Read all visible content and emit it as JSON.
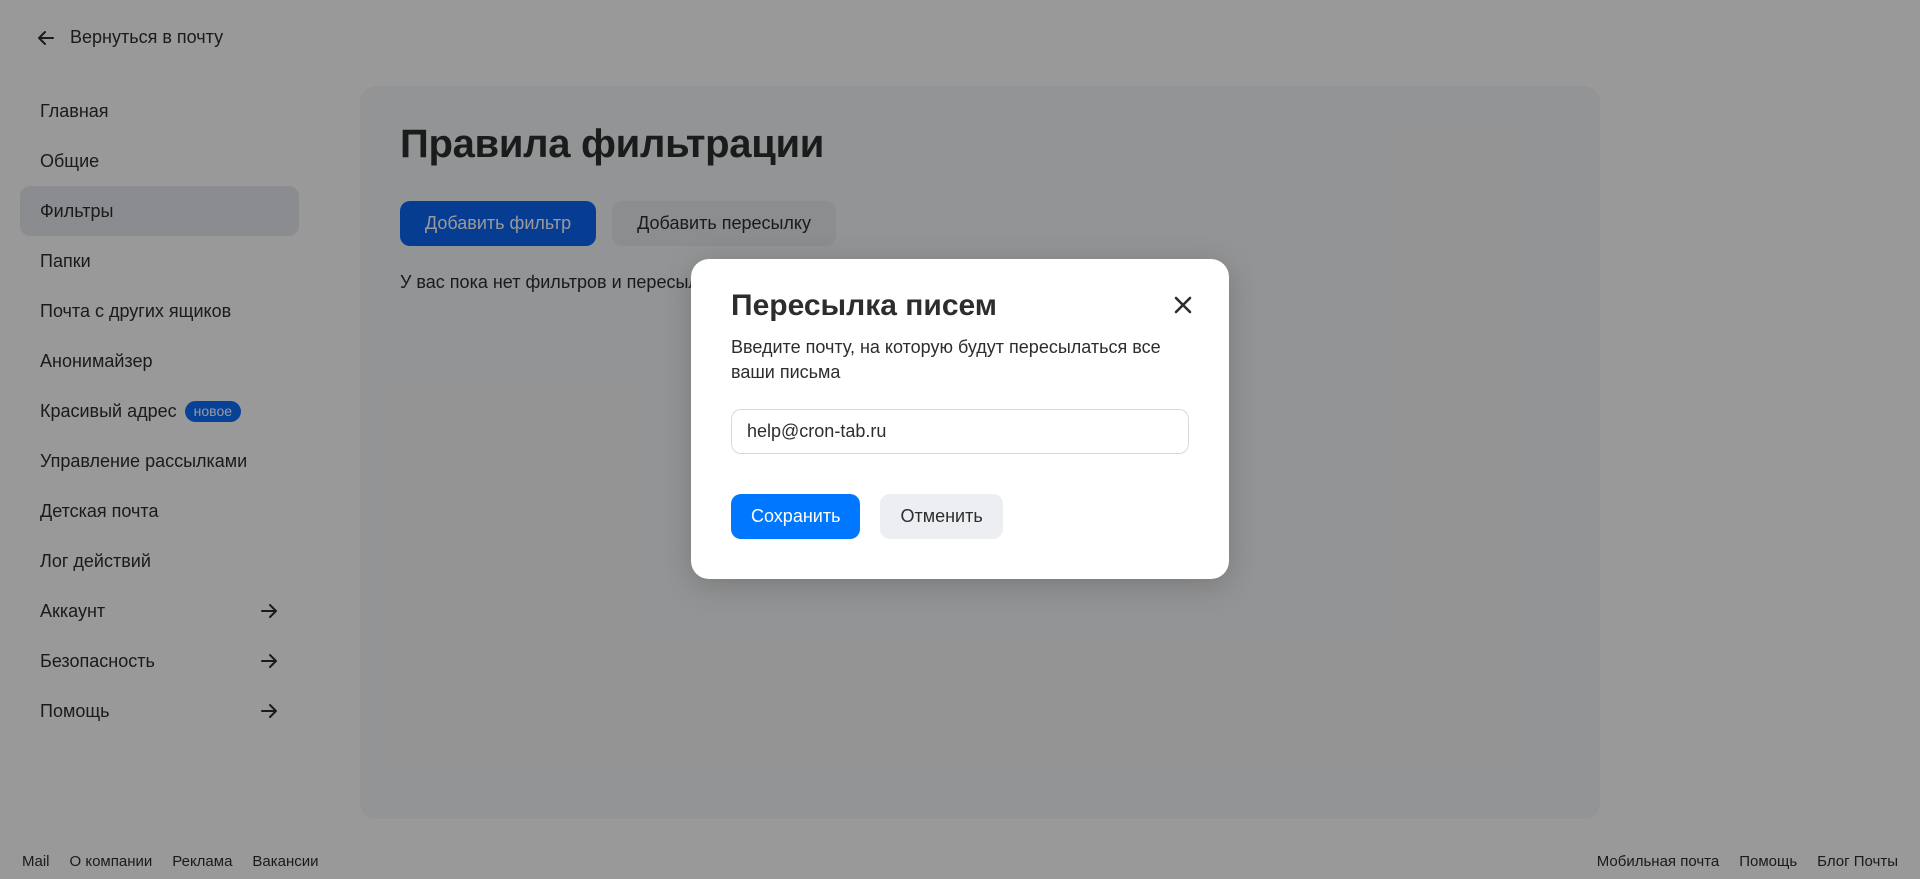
{
  "header": {
    "back_label": "Вернуться в почту"
  },
  "sidebar": {
    "items": [
      {
        "label": "Главная"
      },
      {
        "label": "Общие"
      },
      {
        "label": "Фильтры",
        "active": true
      },
      {
        "label": "Папки"
      },
      {
        "label": "Почта с других ящиков"
      },
      {
        "label": "Анонимайзер"
      },
      {
        "label": "Красивый адрес",
        "badge": "новое"
      },
      {
        "label": "Управление рассылками"
      },
      {
        "label": "Детская почта"
      },
      {
        "label": "Лог действий"
      },
      {
        "label": "Аккаунт",
        "arrow": true
      },
      {
        "label": "Безопасность",
        "arrow": true
      },
      {
        "label": "Помощь",
        "arrow": true
      }
    ]
  },
  "main": {
    "title": "Правила фильтрации",
    "add_filter_label": "Добавить фильтр",
    "add_forward_label": "Добавить пересылку",
    "empty_text": "У вас пока нет фильтров и пересылок"
  },
  "modal": {
    "title": "Пересылка писем",
    "description": "Введите почту, на которую будут пересылаться все ваши письма",
    "input_value": "help@cron-tab.ru",
    "save_label": "Сохранить",
    "cancel_label": "Отменить"
  },
  "footer": {
    "left": [
      "Mail",
      "О компании",
      "Реклама",
      "Вакансии"
    ],
    "right": [
      "Мобильная почта",
      "Помощь",
      "Блог Почты"
    ]
  },
  "colors": {
    "accent": "#0077ff",
    "overlay": "rgba(0,0,0,0.40)",
    "active_nav": "#e6e9ef"
  },
  "icons": {
    "back": "arrow-left-icon",
    "nav_arrow": "arrow-right-icon",
    "close": "close-icon"
  }
}
